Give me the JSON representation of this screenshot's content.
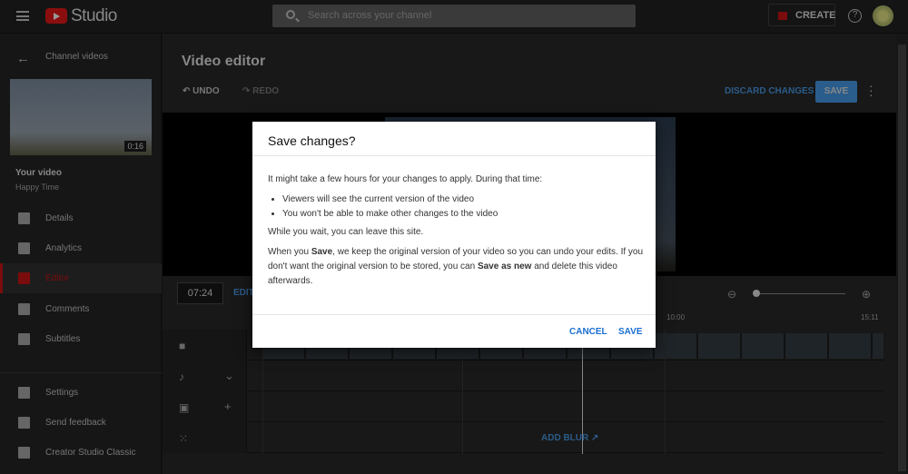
{
  "header": {
    "app_name": "Studio",
    "search_placeholder": "Search across your channel",
    "create_label": "CREATE",
    "help": "?"
  },
  "sidebar": {
    "back_label": "Channel videos",
    "thumbnail_duration": "0:16",
    "your_video": "Your video",
    "video_title": "Happy Time",
    "items": [
      {
        "label": "Details",
        "icon": "pencil-icon"
      },
      {
        "label": "Analytics",
        "icon": "analytics-icon"
      },
      {
        "label": "Editor",
        "icon": "editor-icon",
        "active": true
      },
      {
        "label": "Comments",
        "icon": "comments-icon"
      },
      {
        "label": "Subtitles",
        "icon": "subtitles-icon"
      }
    ],
    "bottom_items": [
      {
        "label": "Settings",
        "icon": "gear-icon"
      },
      {
        "label": "Send feedback",
        "icon": "feedback-icon"
      },
      {
        "label": "Creator Studio Classic",
        "icon": "classic-icon"
      }
    ]
  },
  "editor": {
    "title": "Video editor",
    "undo": "UNDO",
    "redo": "REDO",
    "discard": "DISCARD CHANGES",
    "save": "SAVE",
    "current_time": "07:24",
    "edit_label": "EDIT",
    "ticks": [
      "10:00",
      "15:11"
    ],
    "add_blur": "ADD BLUR"
  },
  "dialog": {
    "title": "Save changes?",
    "intro": "It might take a few hours for your changes to apply. During that time:",
    "bullets": [
      "Viewers will see the current version of the video",
      "You won't be able to make other changes to the video"
    ],
    "wait": "While you wait, you can leave this site.",
    "p_when": "When you ",
    "p_save": "Save",
    "p_mid": ", we keep the original version of your video so you can undo your edits. If you don't want the original version to be stored, you can ",
    "p_saveas": "Save as new",
    "p_end": " and delete this video afterwards.",
    "cancel": "CANCEL",
    "save": "SAVE"
  },
  "colors": {
    "accent": "#1a6fd0",
    "brand_red": "#ff0000"
  }
}
